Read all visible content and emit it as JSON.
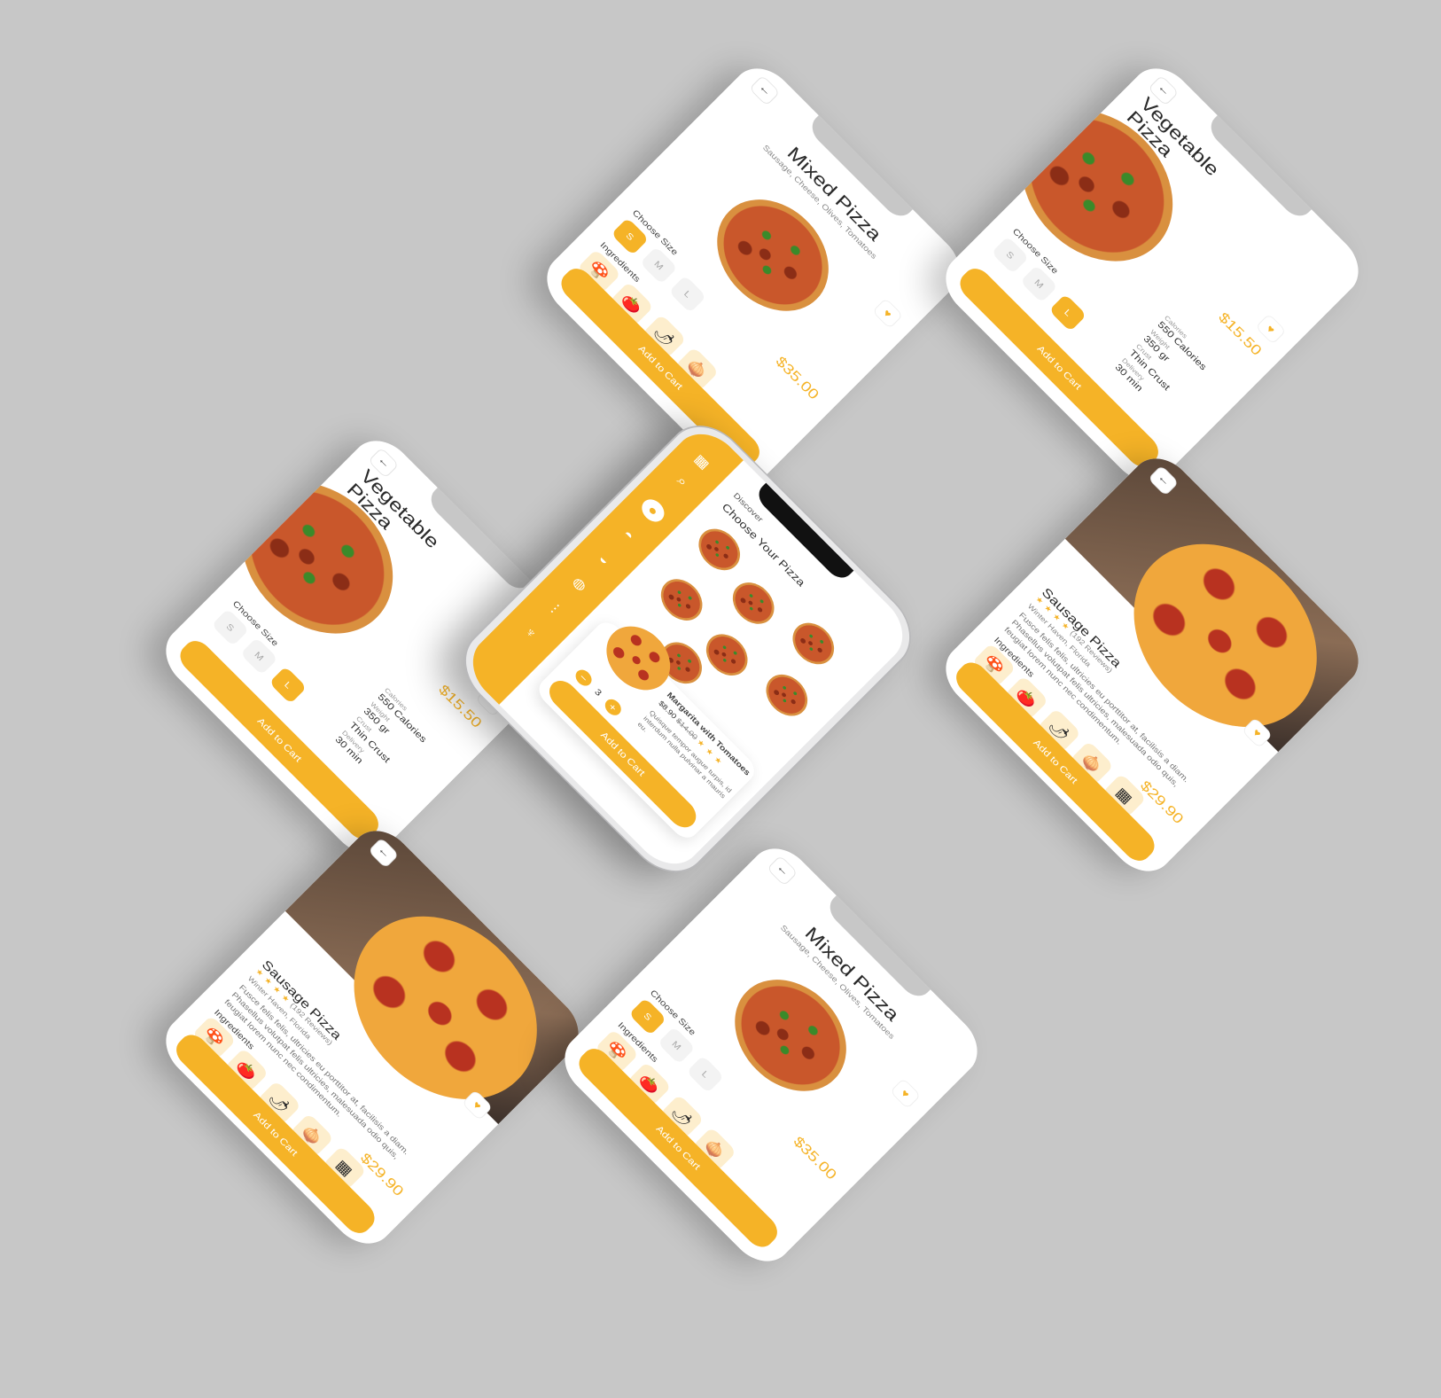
{
  "mixed": {
    "title": "Mixed Pizza",
    "subtitle": "Sausage, Cheese, Olives, Tomatoes",
    "price": "$35.00",
    "choose_size": "Choose Size",
    "sizes": [
      "S",
      "M",
      "L"
    ],
    "ingredients_label": "Ingredients",
    "cart": "Add to Cart"
  },
  "vegetable": {
    "title": "Vegetable Pizza",
    "price": "$15.50",
    "calories_k": "Calories",
    "calories_v": "550 Calories",
    "weight_k": "Weight",
    "weight_v": "350 gr",
    "crust_k": "Crust",
    "crust_v": "Thin Crust",
    "delivery_k": "Delivery",
    "delivery_v": "30 min",
    "choose_size": "Choose Size",
    "sizes": [
      "S",
      "M",
      "L"
    ],
    "cart": "Add to Cart"
  },
  "sausage": {
    "title": "Sausage Pizza",
    "reviews": "(192 Reviews)",
    "location": "Winter Haven, Florida",
    "description": "Fusce felis felis, ultricies eu porttitor at, facilisis a diam. Phasellus volutpat felis ultricies, malesuada odio quis, feugiat lorem nunc nec condimentum.",
    "ingredients_label": "Ingredients",
    "price": "$29.90",
    "cart": "Add to Cart"
  },
  "center": {
    "discover": "Discover",
    "choose": "Choose Your Pizza",
    "item_name": "Margarita with Tomatoes",
    "item_price": "$8.90",
    "item_old_price": "$14.00",
    "item_desc": "Quisque tempor augue turpis, id interdum nulla pulvinar a mauris eu.",
    "qty": "3",
    "minus": "−",
    "plus": "+",
    "cart": "Add to Cart"
  },
  "icons": {
    "back": "←",
    "heart": "♥",
    "grid": "▦",
    "search": "⌕",
    "mushroom": "🍄",
    "tomato": "🍅",
    "chili": "🌶",
    "onion": "🧅",
    "star": "★"
  },
  "colors": {
    "accent": "#f5b327",
    "background": "#c7c7c7"
  }
}
